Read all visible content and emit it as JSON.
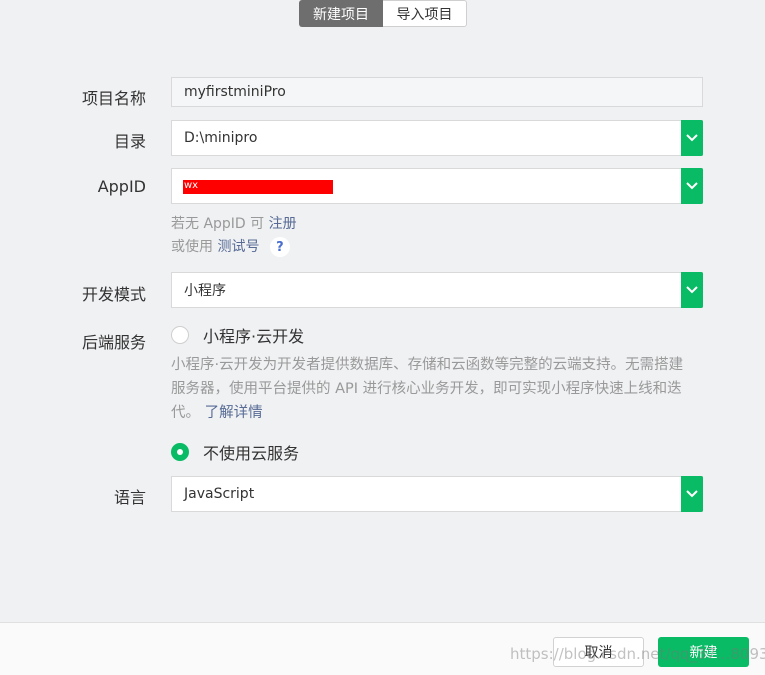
{
  "tabs": {
    "new_project": "新建项目",
    "import_project": "导入项目"
  },
  "form": {
    "project_name": {
      "label": "项目名称",
      "value": "myfirstminiPro"
    },
    "directory": {
      "label": "目录",
      "value": "D:\\minipro"
    },
    "appid": {
      "label": "AppID",
      "value": "wx"
    },
    "appid_hint": {
      "no_appid_prefix": "若无 AppID 可",
      "register_link": "注册",
      "use_prefix": "或使用",
      "test_link": "测试号",
      "help_glyph": "?"
    },
    "dev_mode": {
      "label": "开发模式",
      "value": "小程序"
    },
    "backend": {
      "label": "后端服务",
      "option_cloud": "小程序·云开发",
      "cloud_desc_line1": "小程序·云开发为开发者提供数据库、存储和云函数等完整的云端支持。无需搭建",
      "cloud_desc_line2": "服务器，使用平台提供的 API 进行核心业务开发，即可实现小程序快速上线和迭",
      "cloud_desc_line3": "代。",
      "learn_more": "了解详情",
      "option_none": "不使用云服务",
      "selected": "不使用云服务"
    },
    "language": {
      "label": "语言",
      "value": "JavaScript"
    }
  },
  "footer": {
    "cancel": "取消",
    "create": "新建"
  },
  "watermark": "https://blog.csdn.net/qq_37...8093",
  "colors": {
    "accent": "#09bb64",
    "link": "#576b95",
    "redaction": "#ff0000"
  },
  "icons": {
    "dropdown": "chevron-down-icon",
    "help": "question-icon"
  }
}
